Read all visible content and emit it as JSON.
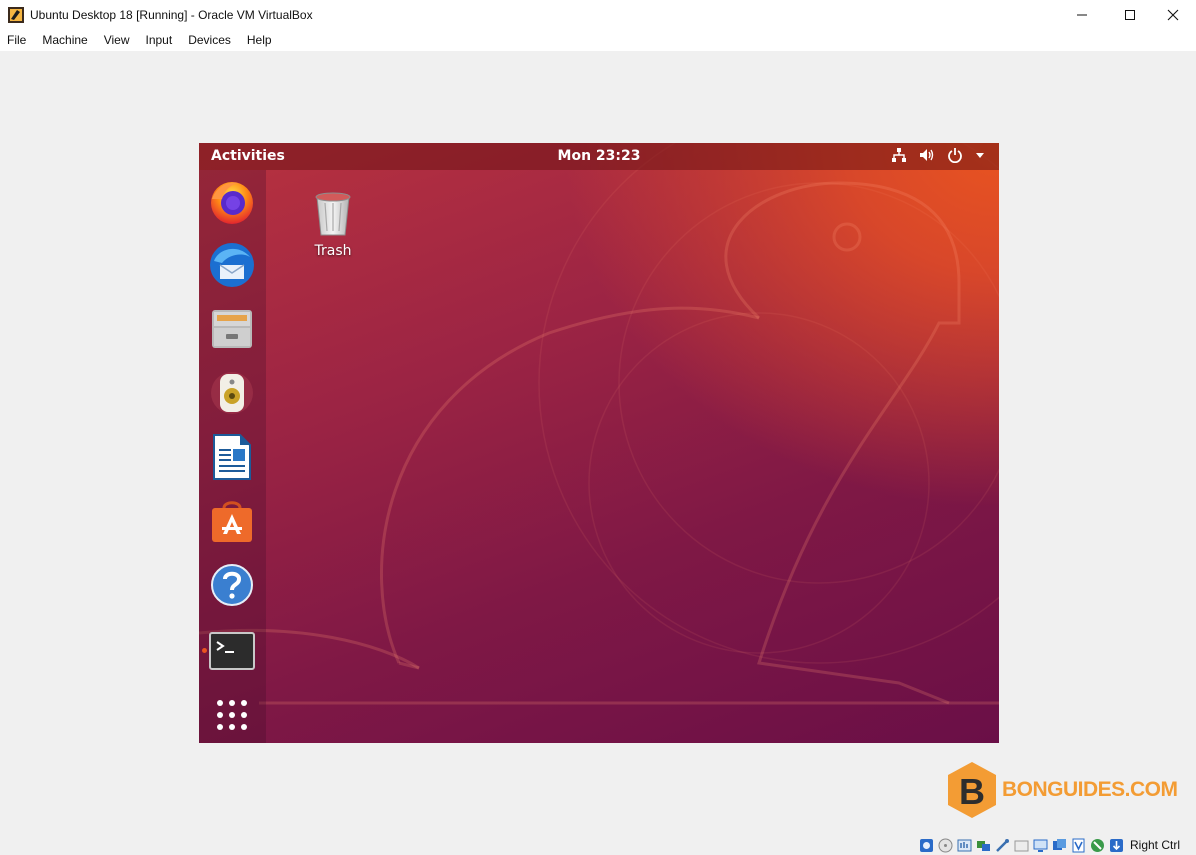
{
  "window": {
    "title": "Ubuntu Desktop 18 [Running] - Oracle VM VirtualBox",
    "controls": [
      "minimize-icon",
      "maximize-icon",
      "close-icon"
    ]
  },
  "menubar": {
    "items": [
      {
        "label": "File"
      },
      {
        "label": "Machine"
      },
      {
        "label": "View"
      },
      {
        "label": "Input"
      },
      {
        "label": "Devices"
      },
      {
        "label": "Help"
      }
    ]
  },
  "guest": {
    "topbar": {
      "activities": "Activities",
      "clock": "Mon 23:23",
      "tray_icons": [
        "network-icon",
        "volume-icon",
        "power-icon",
        "menu-arrow-icon"
      ]
    },
    "dock": {
      "apps": [
        {
          "name": "firefox-icon"
        },
        {
          "name": "thunderbird-icon"
        },
        {
          "name": "files-icon"
        },
        {
          "name": "rhythmbox-icon"
        },
        {
          "name": "libreoffice-writer-icon"
        },
        {
          "name": "ubuntu-software-icon"
        },
        {
          "name": "help-icon"
        },
        {
          "name": "terminal-icon",
          "running": true
        },
        {
          "name": "show-applications-icon"
        }
      ]
    },
    "desktop": {
      "icons": [
        {
          "label": "Trash",
          "icon": "trash-icon"
        }
      ]
    },
    "accent_color": "#e95420"
  },
  "watermark": {
    "letter": "B",
    "text": "BONGUIDES.COM",
    "color": "#f39c34"
  },
  "statusbar": {
    "host_key": "Right Ctrl",
    "icons": [
      "hard-disk-icon",
      "optical-drive-icon",
      "audio-icon",
      "network-adapter-icon",
      "usb-icon",
      "shared-folders-icon",
      "display-icon",
      "recording-icon",
      "virtualization-icon",
      "mouse-integration-icon",
      "keyboard-capture-icon"
    ]
  }
}
